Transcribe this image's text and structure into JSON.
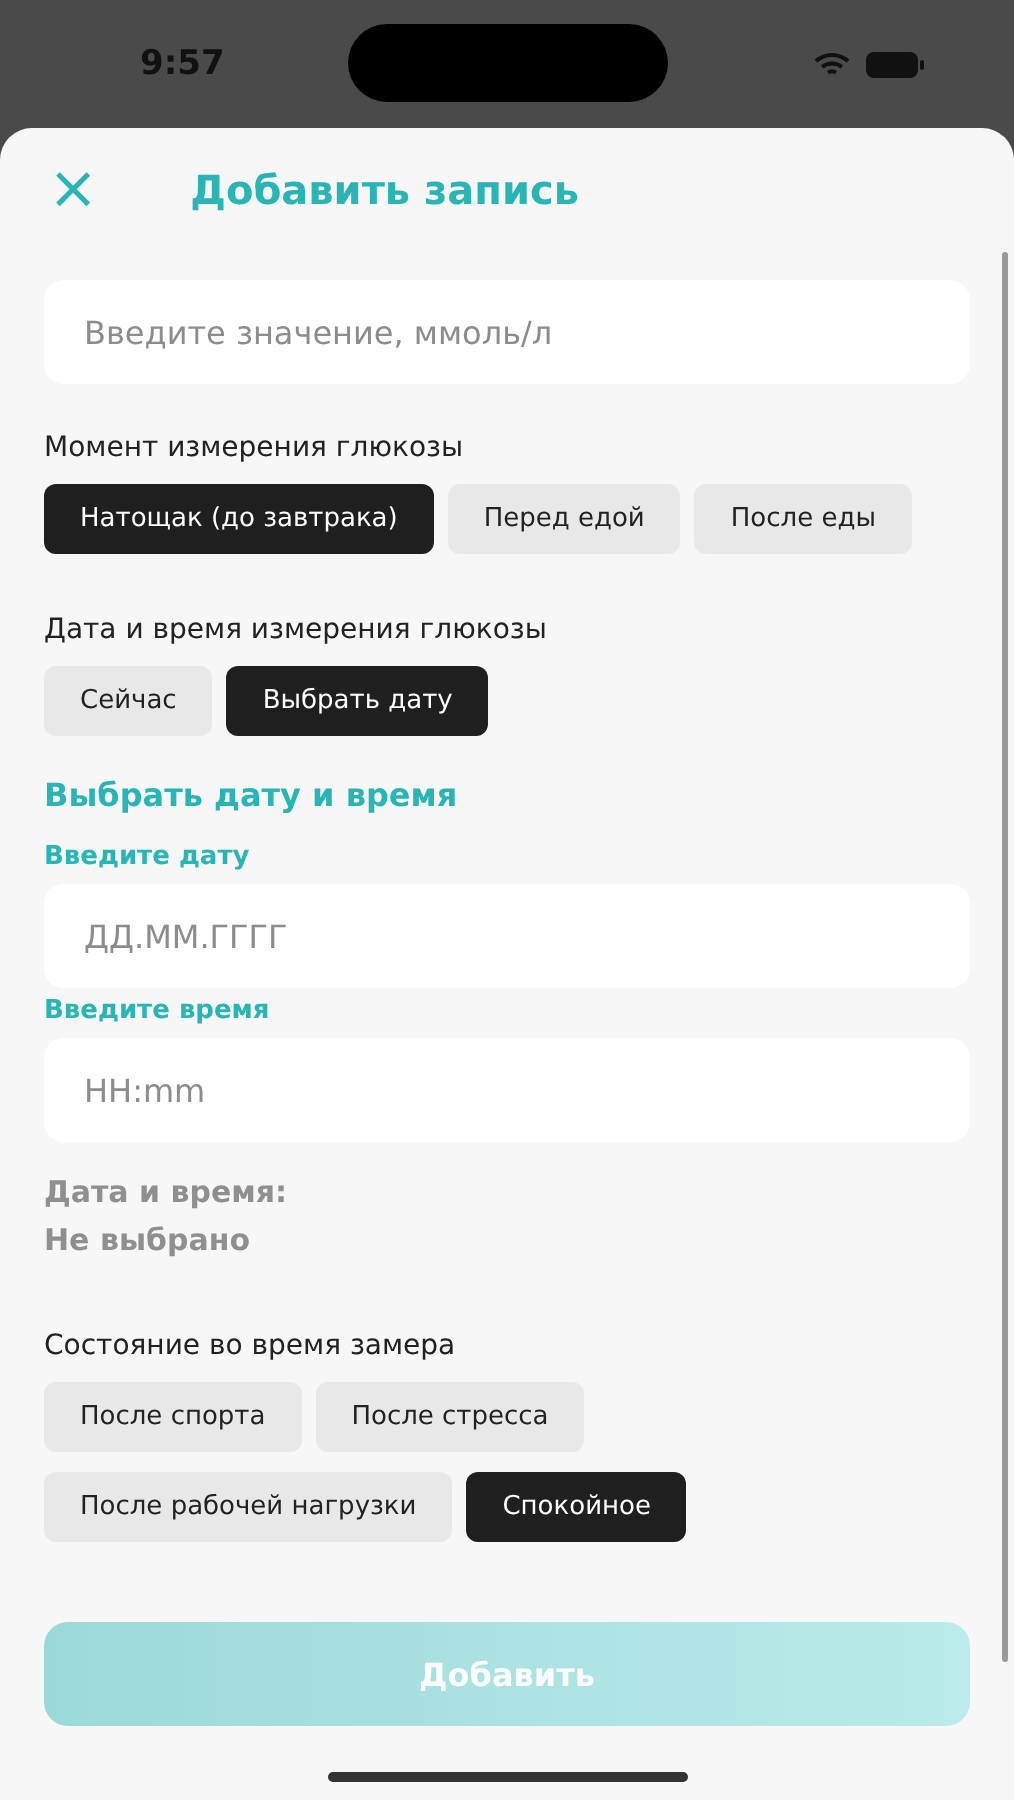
{
  "status_bar": {
    "time": "9:57"
  },
  "header": {
    "close": "×",
    "title": "Добавить запись"
  },
  "value_field": {
    "placeholder": "Введите значение, ммоль/л"
  },
  "moment": {
    "label": "Момент измерения глюкозы",
    "options": [
      {
        "label": "Натощак (до завтрака)",
        "selected": true
      },
      {
        "label": "Перед едой",
        "selected": false
      },
      {
        "label": "После еды",
        "selected": false
      }
    ]
  },
  "datetime": {
    "label": "Дата и время измерения глюкозы",
    "options": [
      {
        "label": "Сейчас",
        "selected": false
      },
      {
        "label": "Выбрать дату",
        "selected": true
      }
    ]
  },
  "picker": {
    "title": "Выбрать дату и время",
    "date_label": "Введите дату",
    "date_placeholder": "ДД.ММ.ГГГГ",
    "time_label": "Введите время",
    "time_placeholder": "HH:mm",
    "summary_label": "Дата и время:",
    "summary_value": "Не выбрано"
  },
  "state": {
    "label": "Состояние во время замера",
    "options": [
      {
        "label": "После спорта",
        "selected": false
      },
      {
        "label": "После стресса",
        "selected": false
      },
      {
        "label": "После рабочей нагрузки",
        "selected": false
      },
      {
        "label": "Спокойное",
        "selected": true
      }
    ]
  },
  "submit": {
    "label": "Добавить",
    "disabled": true
  }
}
